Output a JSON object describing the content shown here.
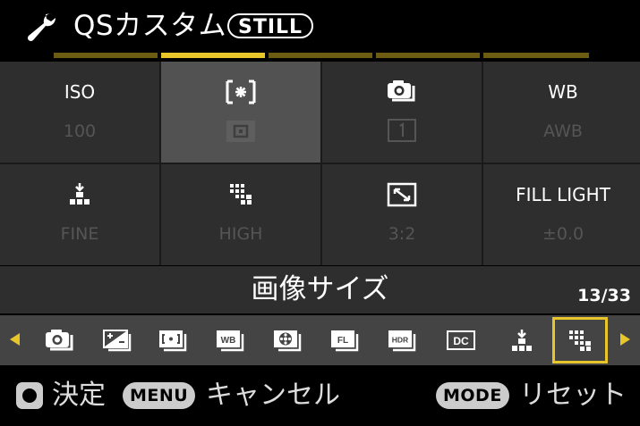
{
  "header": {
    "title": "QSカスタム",
    "badge": "STILL"
  },
  "tabs": {
    "count": 5,
    "active_index": 1
  },
  "grid": [
    {
      "label": "ISO",
      "value": "100",
      "icon": ""
    },
    {
      "label": "",
      "value": "",
      "icon": "spot-metering-icon",
      "value_icon": "af-point-icon",
      "selected": true
    },
    {
      "label": "",
      "value": "",
      "icon": "drive-mode-icon",
      "value_icon": "single-frame-icon"
    },
    {
      "label": "WB",
      "value": "AWB",
      "icon": ""
    },
    {
      "label": "",
      "value": "FINE",
      "icon": "image-quality-icon"
    },
    {
      "label": "",
      "value": "HIGH",
      "icon": "image-size-icon"
    },
    {
      "label": "",
      "value": "3:2",
      "icon": "aspect-ratio-icon"
    },
    {
      "label": "FILL LIGHT",
      "value": "±0.0",
      "icon": ""
    }
  ],
  "info": {
    "item_name": "画像サイズ",
    "counter": "13/33"
  },
  "strip": [
    {
      "icon": "drive-mode-icon"
    },
    {
      "icon": "exposure-comp-icon"
    },
    {
      "icon": "metering-icon"
    },
    {
      "icon": "white-balance-icon",
      "text": "WB"
    },
    {
      "icon": "film-mode-icon"
    },
    {
      "icon": "fill-light-icon",
      "text": "FL"
    },
    {
      "icon": "hdr-icon",
      "text": "HDR"
    },
    {
      "icon": "dc-icon",
      "text": "DC"
    },
    {
      "icon": "image-quality-icon"
    },
    {
      "icon": "image-size-icon",
      "selected": true
    }
  ],
  "footer": {
    "ok_label": "決定",
    "menu_key": "MENU",
    "menu_label": "キャンセル",
    "mode_key": "MODE",
    "mode_label": "リセット"
  },
  "colors": {
    "accent": "#e8c62a",
    "accent_dim": "#6b5c12",
    "cell": "#2e2e2e",
    "cell_selected": "#525252"
  }
}
